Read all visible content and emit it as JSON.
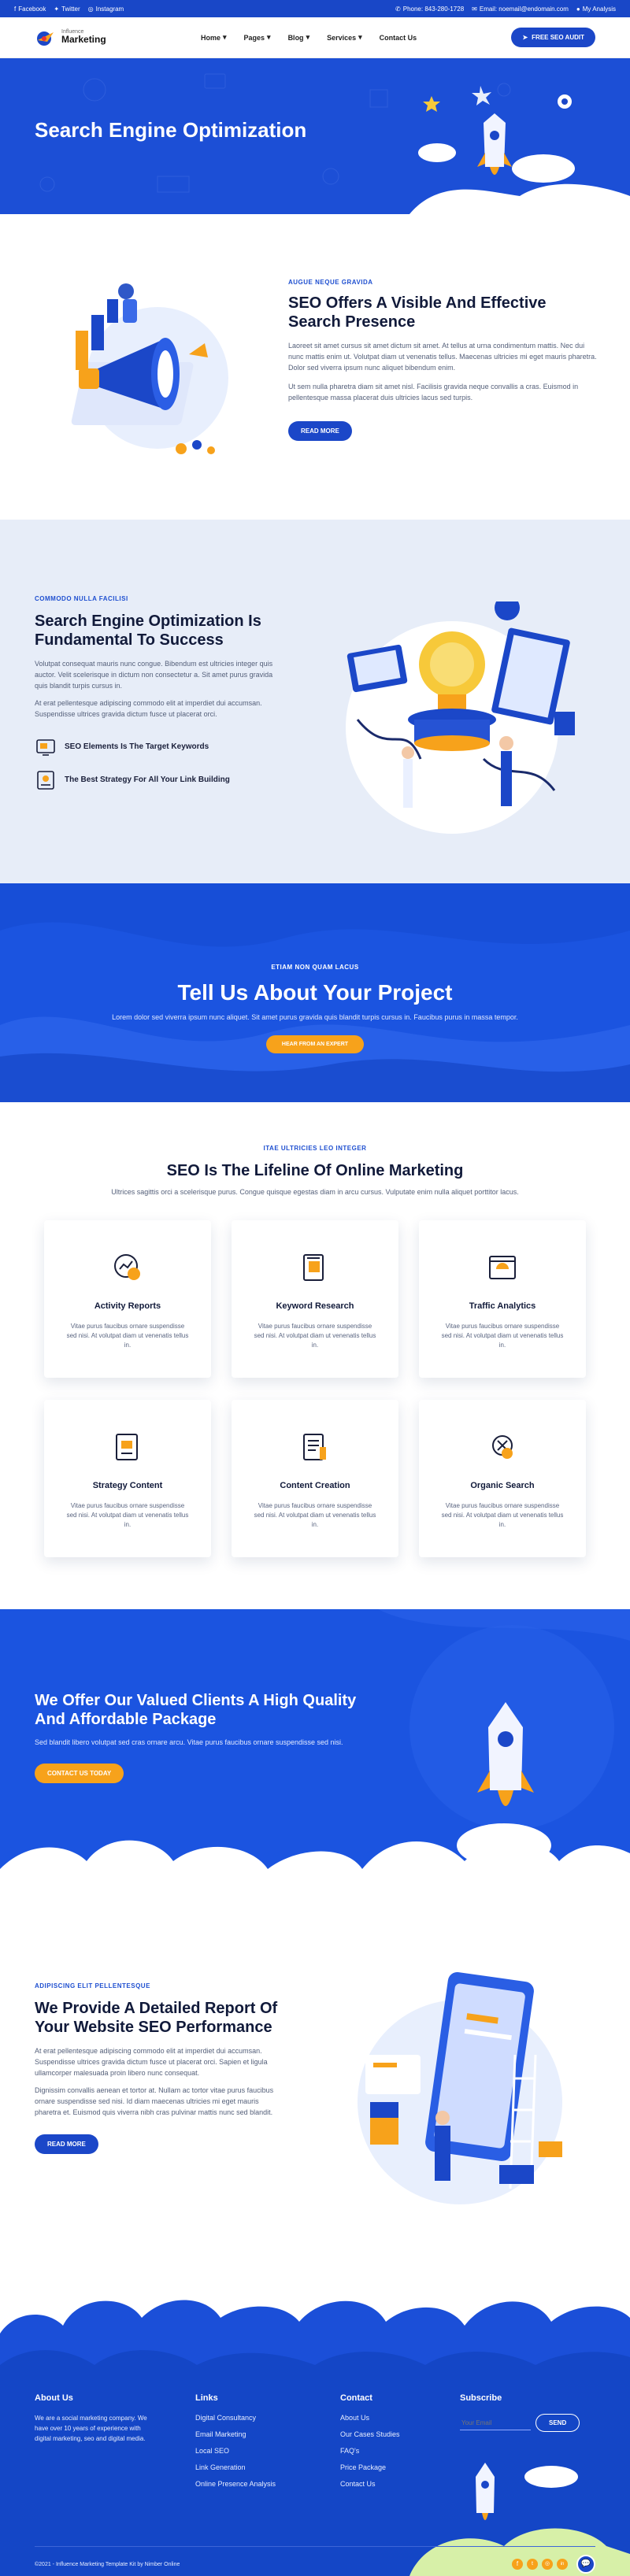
{
  "topbar": {
    "social": [
      "Facebook",
      "Twitter",
      "Instagram"
    ],
    "phone": "Phone: 843-280-1728",
    "email": "Email: noemail@endomain.com",
    "account": "My Analysis"
  },
  "nav": {
    "logo_top": "Influence",
    "logo_bottom": "Marketing",
    "items": [
      "Home",
      "Pages",
      "Blog",
      "Services",
      "Contact Us"
    ],
    "cta": "FREE SEO AUDIT"
  },
  "hero": {
    "title": "Search Engine Optimization"
  },
  "s1": {
    "kicker": "AUGUE NEQUE GRAVIDA",
    "title": "SEO Offers A Visible And Effective Search Presence",
    "p1": "Laoreet sit amet cursus sit amet dictum sit amet. At tellus at urna condimentum mattis. Nec dui nunc mattis enim ut. Volutpat diam ut venenatis tellus. Maecenas ultricies mi eget mauris pharetra. Dolor sed viverra ipsum nunc aliquet bibendum enim.",
    "p2": "Ut sem nulla pharetra diam sit amet nisl. Facilisis gravida neque convallis a cras. Euismod in pellentesque massa placerat duis ultricies lacus sed turpis.",
    "button": "READ MORE"
  },
  "s2": {
    "kicker": "COMMODO NULLA FACILISI",
    "title": "Search Engine Optimization Is Fundamental To Success",
    "p1": "Volutpat consequat mauris nunc congue. Bibendum est ultricies integer quis auctor. Velit scelerisque in dictum non consectetur a. Sit amet purus gravida quis blandit turpis cursus in.",
    "p2": "At erat pellentesque adipiscing commodo elit at imperdiet dui accumsan. Suspendisse ultrices gravida dictum fusce ut placerat orci.",
    "feature1": "SEO Elements Is The Target Keywords",
    "feature2": "The Best Strategy For All Your Link Building"
  },
  "s3": {
    "kicker": "ETIAM NON QUAM LACUS",
    "title": "Tell Us About Your Project",
    "desc": "Lorem dolor sed viverra ipsum nunc aliquet. Sit amet purus gravida quis blandit turpis cursus in. Faucibus purus in massa tempor.",
    "button": "HEAR FROM AN EXPERT"
  },
  "s4": {
    "kicker": "ITAE ULTRICIES LEO INTEGER",
    "title": "SEO Is The Lifeline Of Online Marketing",
    "desc": "Ultrices sagittis orci a scelerisque purus. Congue quisque egestas diam in arcu cursus. Vulputate enim nulla aliquet porttitor lacus.",
    "cards": [
      {
        "title": "Activity Reports",
        "icon": "activity-reports-icon",
        "desc": "Vitae purus faucibus ornare suspendisse sed nisi. At volutpat diam ut venenatis tellus in."
      },
      {
        "title": "Keyword Research",
        "icon": "keyword-research-icon",
        "desc": "Vitae purus faucibus ornare suspendisse sed nisi. At volutpat diam ut venenatis tellus in."
      },
      {
        "title": "Traffic Analytics",
        "icon": "traffic-analytics-icon",
        "desc": "Vitae purus faucibus ornare suspendisse sed nisi. At volutpat diam ut venenatis tellus in."
      },
      {
        "title": "Strategy Content",
        "icon": "strategy-content-icon",
        "desc": "Vitae purus faucibus ornare suspendisse sed nisi. At volutpat diam ut venenatis tellus in."
      },
      {
        "title": "Content Creation",
        "icon": "content-creation-icon",
        "desc": "Vitae purus faucibus ornare suspendisse sed nisi. At volutpat diam ut venenatis tellus in."
      },
      {
        "title": "Organic Search",
        "icon": "organic-search-icon",
        "desc": "Vitae purus faucibus ornare suspendisse sed nisi. At volutpat diam ut venenatis tellus in."
      }
    ]
  },
  "s5": {
    "title": "We Offer Our Valued Clients A High Quality And Affordable Package",
    "desc": "Sed blandit libero volutpat sed cras ornare arcu. Vitae purus faucibus ornare suspendisse sed nisi.",
    "button": "CONTACT US TODAY"
  },
  "s6": {
    "kicker": "ADIPISCING ELIT PELLENTESQUE",
    "title": "We Provide A Detailed Report Of Your Website SEO Performance",
    "p1": "At erat pellentesque adipiscing commodo elit at imperdiet dui accumsan. Suspendisse ultrices gravida dictum fusce ut placerat orci. Sapien et ligula ullamcorper malesuada proin libero nunc consequat.",
    "p2": "Dignissim convallis aenean et tortor at. Nullam ac tortor vitae purus faucibus ornare suspendisse sed nisi. Id diam maecenas ultricies mi eget mauris pharetra et. Euismod quis viverra nibh cras pulvinar mattis nunc sed blandit.",
    "button": "READ MORE"
  },
  "footer": {
    "about_title": "About Us",
    "about_text": "We are a social marketing company. We have over 10 years of experience with digital marketing, seo and digital media.",
    "links_title": "Links",
    "links": [
      "Digital Consultancy",
      "Email Marketing",
      "Local SEO",
      "Link Generation",
      "Online Presence Analysis"
    ],
    "contact_title": "Contact",
    "contact": [
      "About Us",
      "Our Cases Studies",
      "FAQ's",
      "Price Package",
      "Contact Us"
    ],
    "subscribe_title": "Subscribe",
    "email_placeholder": "Your Email",
    "send": "SEND",
    "copyright": "©2021 - Influence Marketing Template Kit by Nimber Online"
  },
  "colors": {
    "primary": "#1b47c8",
    "accent": "#f7a21b",
    "dark": "#111a3a"
  }
}
